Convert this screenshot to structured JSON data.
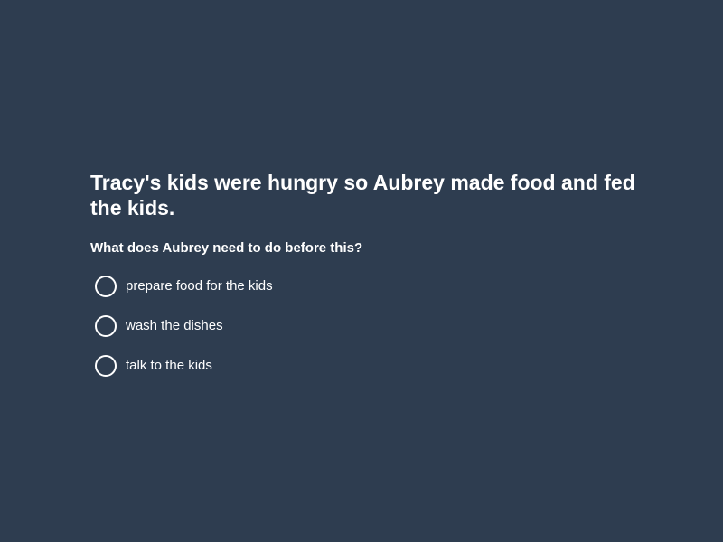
{
  "quiz": {
    "context": "Tracy's kids were hungry so Aubrey made food and fed the kids.",
    "question": "What does Aubrey need to do before this?",
    "options": [
      {
        "label": "prepare food for the kids"
      },
      {
        "label": "wash the dishes"
      },
      {
        "label": "talk to the kids"
      }
    ]
  },
  "colors": {
    "background": "#2e3d50",
    "text": "#ffffff"
  }
}
